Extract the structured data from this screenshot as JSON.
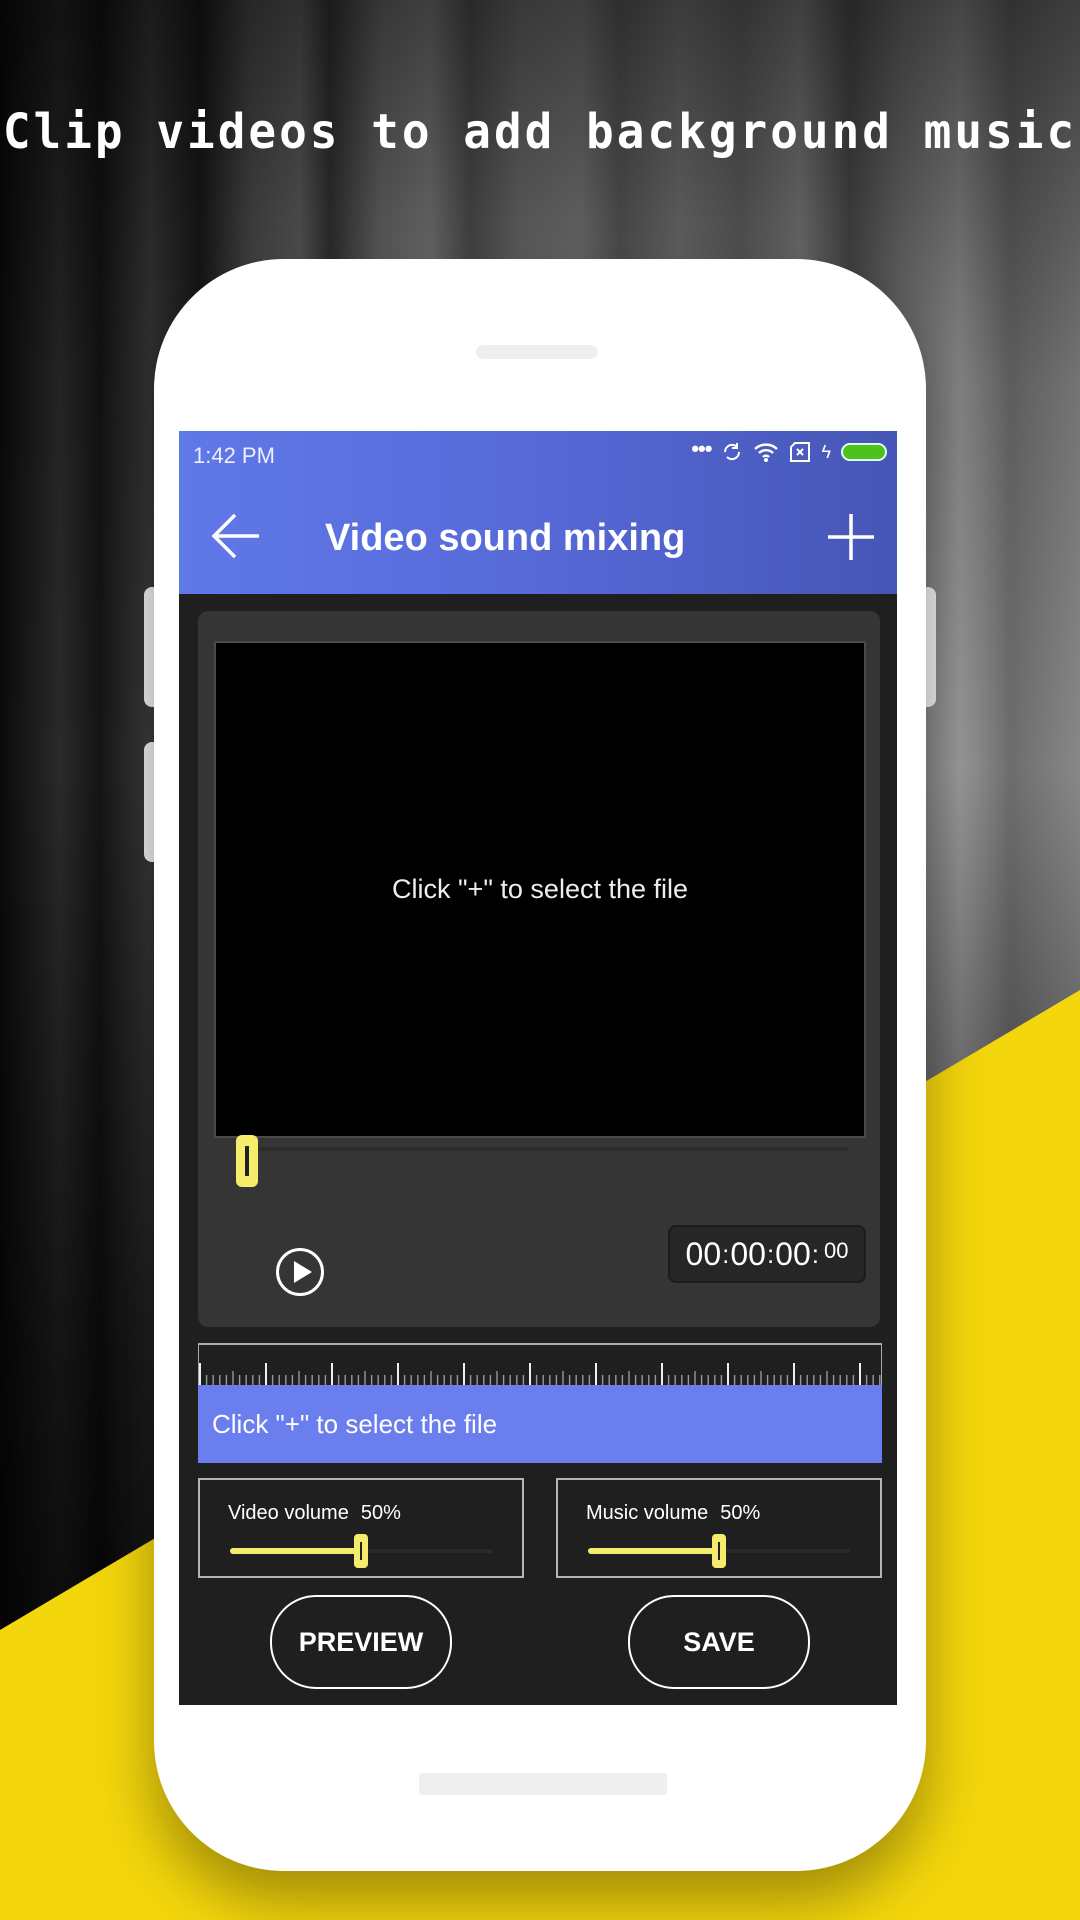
{
  "headline": "Clip videos to add background music",
  "status_bar": {
    "time": "1:42 PM",
    "icons": [
      "more-dots-icon",
      "sync-icon",
      "wifi-icon",
      "sim-x-icon",
      "charging-bolt-icon",
      "battery-icon"
    ],
    "battery_color": "#4ec11a"
  },
  "app_bar": {
    "title": "Video sound mixing",
    "back_icon": "arrow-left-icon",
    "add_icon": "plus-icon",
    "gradient": [
      "#6079e8",
      "#4656b6"
    ]
  },
  "player": {
    "placeholder": "Click \"+\" to select the file",
    "seek_position": 0,
    "timer": {
      "hh": "00",
      "mm": "00",
      "ss": "00",
      "ff": "00"
    }
  },
  "music_track": {
    "placeholder": "Click \"+\" to select the file",
    "color": "#6a7eee"
  },
  "volumes": {
    "video": {
      "label": "Video volume",
      "value_text": "50%",
      "value": 0.5
    },
    "music": {
      "label": "Music volume",
      "value_text": "50%",
      "value": 0.5
    }
  },
  "buttons": {
    "preview": "PREVIEW",
    "save": "SAVE"
  },
  "accent_colors": {
    "slider": "#f5ec6c",
    "background_yellow": "#f4d60c"
  }
}
